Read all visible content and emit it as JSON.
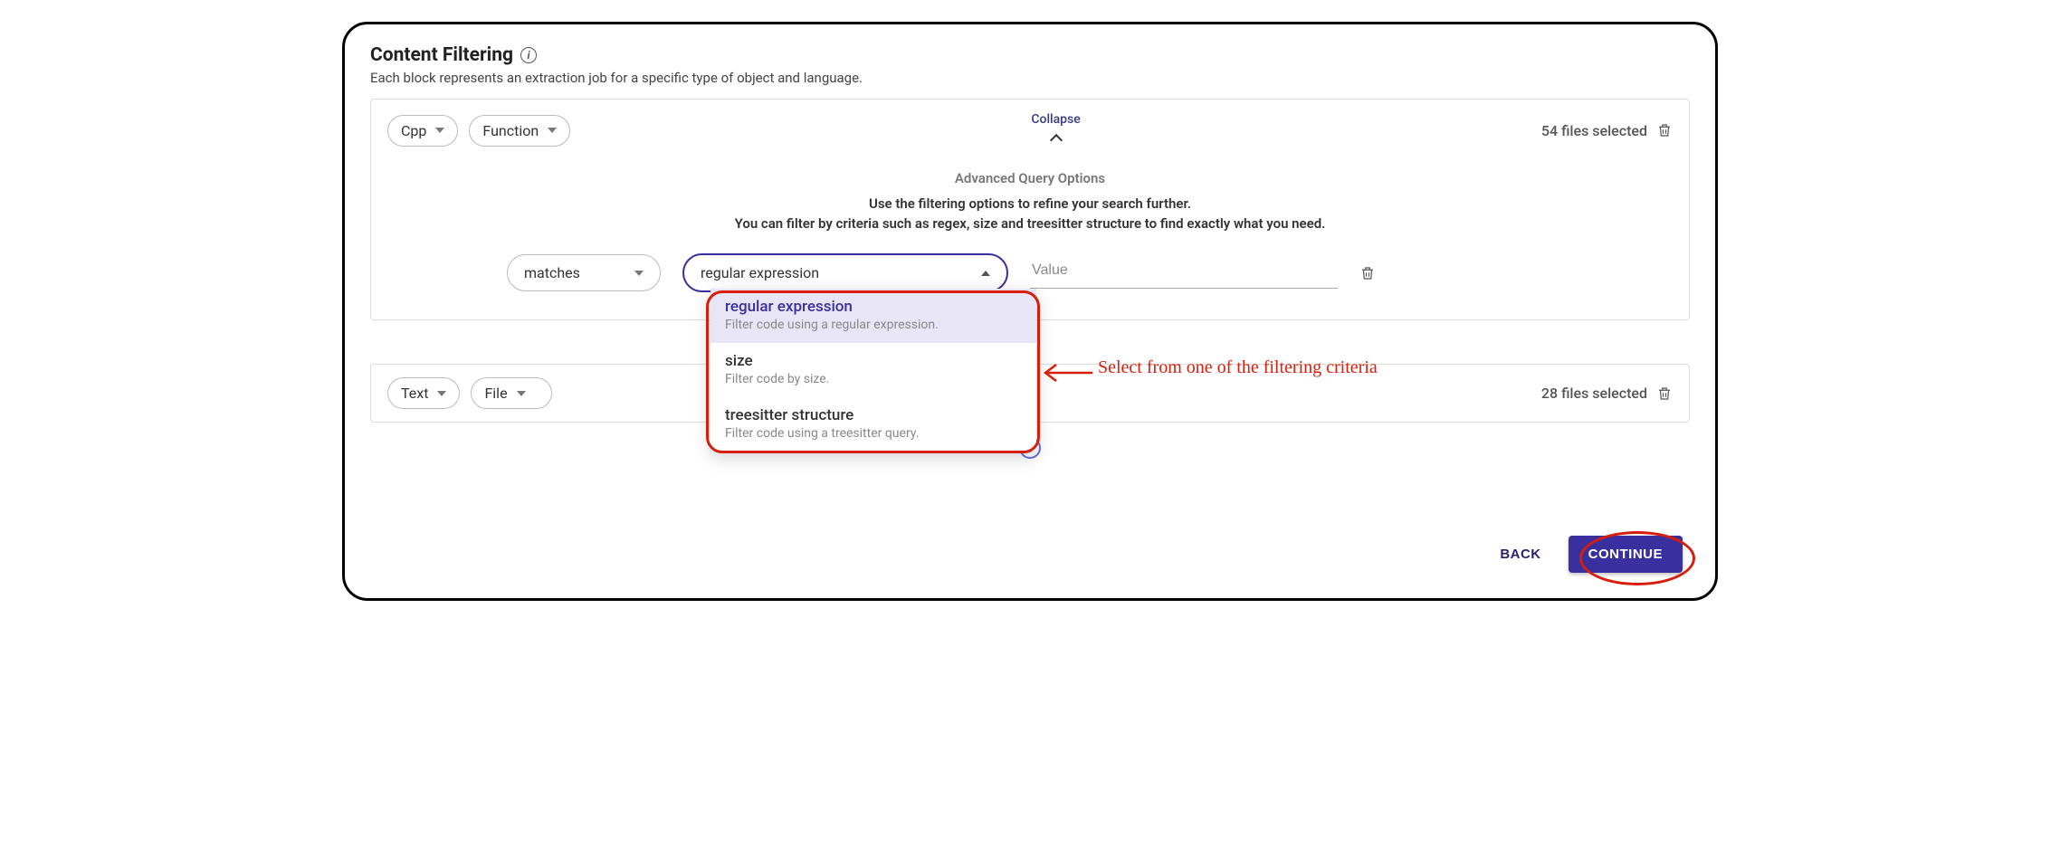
{
  "header": {
    "title": "Content Filtering",
    "subtitle": "Each block represents an extraction job for a specific type of object and language."
  },
  "block1": {
    "lang": "Cpp",
    "object": "Function",
    "collapse_label": "Collapse",
    "files_selected": "54 files selected",
    "adv_title": "Advanced Query Options",
    "adv_line1": "Use the filtering options to refine your search further.",
    "adv_line2": "You can filter by criteria such as regex, size and treesitter structure to find exactly what you need.",
    "matcher": "matches",
    "criteria_selected": "regular expression",
    "value_placeholder": "Value"
  },
  "dropdown": {
    "options": [
      {
        "title": "regular expression",
        "sub": "Filter code using a regular expression."
      },
      {
        "title": "size",
        "sub": "Filter code by size."
      },
      {
        "title": "treesitter structure",
        "sub": "Filter code using a treesitter query."
      }
    ]
  },
  "block2": {
    "lang": "Text",
    "object": "File",
    "files_selected": "28 files selected"
  },
  "annotations": {
    "dropdown_hint": "Select from one of the filtering criteria"
  },
  "footer": {
    "back": "BACK",
    "continue": "CONTINUE"
  }
}
